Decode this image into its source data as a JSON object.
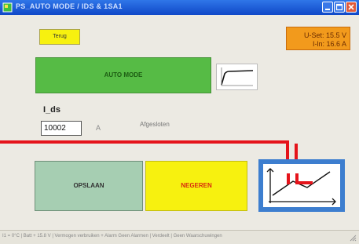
{
  "window": {
    "title": "PS_AUTO MODE / IDS & 1SA1",
    "controls": [
      "minimize-icon",
      "maximize-icon",
      "close-icon"
    ]
  },
  "toolbar": {
    "back_label": "Terug"
  },
  "status": {
    "line1": "U-Set: 15.5 V",
    "line2": "I-ln: 16.6 A",
    "color": "#f29a1c"
  },
  "mode": {
    "label": "AUTO MODE",
    "color": "#56bb45",
    "curve_icon": "curve-icon"
  },
  "field": {
    "label": "I_ds",
    "value": "10002",
    "unit": "A",
    "state": "Afgesloten"
  },
  "actions": {
    "save_label": "OPSLAAN",
    "ignore_label": "NEGEREN",
    "save_color": "#a6ceb2",
    "ignore_color": "#f7f10f",
    "chart_icon": "line-chart-icon"
  },
  "statusbar": {
    "text": "I1 = 0°C | Batt + 15.8 V | Vermogen verbruiken + Alarm Geen Alarmen | Verdeelt | Geen Waarschuwingen"
  }
}
